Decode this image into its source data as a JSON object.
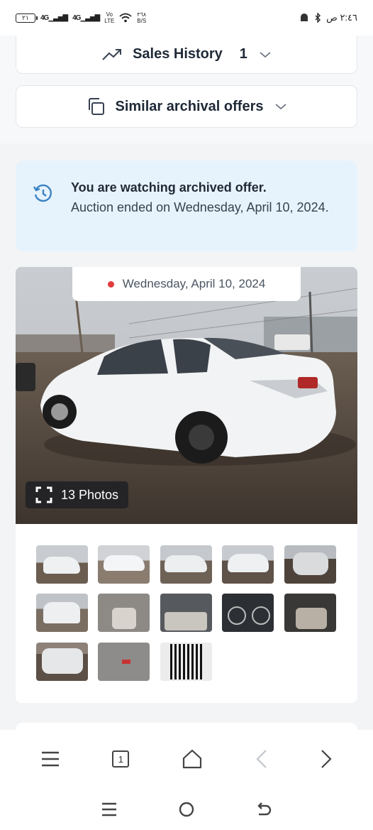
{
  "status_bar": {
    "battery": "٢١",
    "signal_1": "4G",
    "signal_2": "4G",
    "volte_top": "Vo",
    "volte_bottom": "LTE",
    "speed_top": "٣٦٨",
    "speed_bottom": "B/S",
    "time": "٢:٤٦ ص"
  },
  "accordions": {
    "sales_history_label": "Sales History",
    "sales_history_count": "1",
    "similar_offers_label": "Similar archival offers"
  },
  "notice": {
    "title": "You are watching archived offer.",
    "body": "Auction ended on Wednesday, April 10, 2024."
  },
  "gallery": {
    "date": "Wednesday, April 10, 2024",
    "photos_label": "13 Photos",
    "thumbnails": [
      "car-front-left",
      "car-side-left",
      "car-side-left-2",
      "car-front-right",
      "car-front-damage",
      "car-rear",
      "interior-front-seats",
      "interior-dashboard",
      "instrument-cluster",
      "interior-rear-seats",
      "front-crash",
      "ground-debris",
      "window-sticker"
    ]
  },
  "browser_nav": {
    "tab_count": "1",
    "icons": [
      "menu-icon",
      "tabs-icon",
      "home-icon",
      "back-icon",
      "forward-icon"
    ]
  },
  "colors": {
    "notice_bg": "#e7f3fc",
    "notice_icon": "#3b82c4",
    "live_dot": "#e23b3b"
  }
}
